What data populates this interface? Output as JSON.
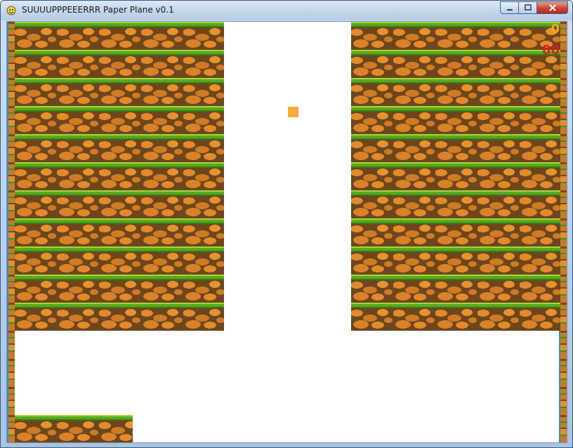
{
  "window": {
    "title": "SUUUUPPPEEERRR Paper Plane v0.1",
    "icon": "pygame-snake-icon",
    "controls": [
      "minimize-icon",
      "maximize-icon",
      "close-icon"
    ]
  },
  "game": {
    "score": "0",
    "counter": "80",
    "player": "paper-plane-square",
    "colors": {
      "player": "#f8ad3a",
      "score": "#f4a62a",
      "counter": "#e21b1b",
      "sky": "#ffffff",
      "grass": "#58a91e",
      "dirt": "#6e461c",
      "water_edge": "#2f8cd6"
    }
  }
}
